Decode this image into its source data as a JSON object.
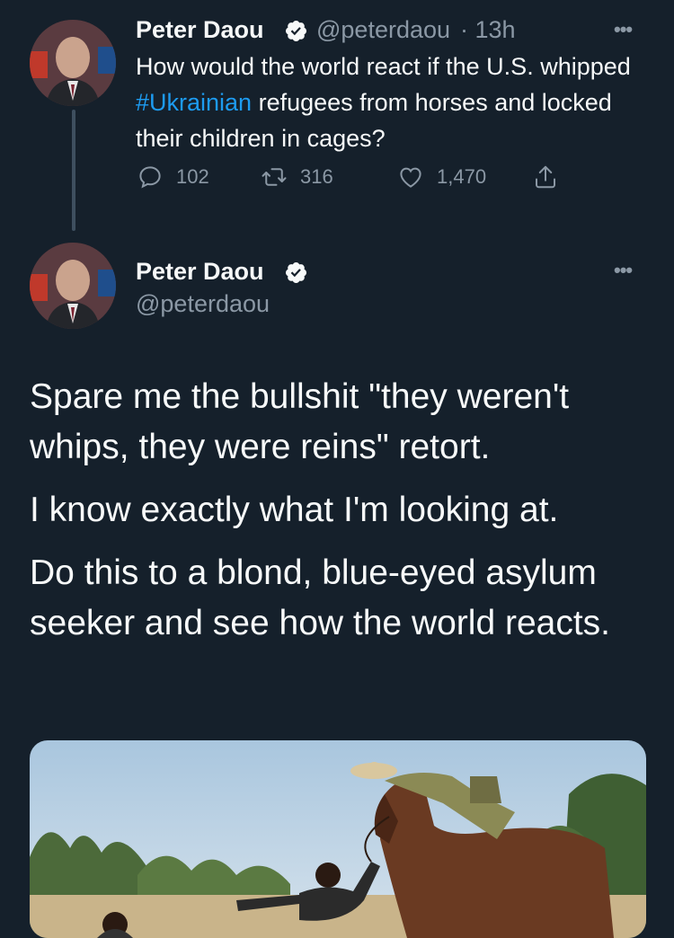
{
  "tweet1": {
    "name": "Peter Daou",
    "handle": "@peterdaou",
    "time": "· 13h",
    "text_before": "How would the world react if the U.S. whipped ",
    "hashtag": "#Ukrainian",
    "text_after": " refugees from horses and locked their children in cages?",
    "replies": "102",
    "retweets": "316",
    "likes": "1,470"
  },
  "tweet2": {
    "name": "Peter Daou",
    "handle": "@peterdaou",
    "paragraphs": [
      "Spare me the bullshit \"they weren't whips, they were reins\" retort.",
      "I know exactly what I'm looking at.",
      "Do this to a blond, blue-eyed asylum seeker and see how the world reacts."
    ]
  },
  "icons": {
    "more": "more-horizontal-icon",
    "verified": "verified-badge-icon",
    "reply": "reply-icon",
    "retweet": "retweet-icon",
    "like": "heart-icon",
    "share": "share-icon"
  },
  "colors": {
    "background": "#15202b",
    "accent": "#1d9bf0",
    "muted": "#8b98a5",
    "text": "#f7f9f9"
  }
}
